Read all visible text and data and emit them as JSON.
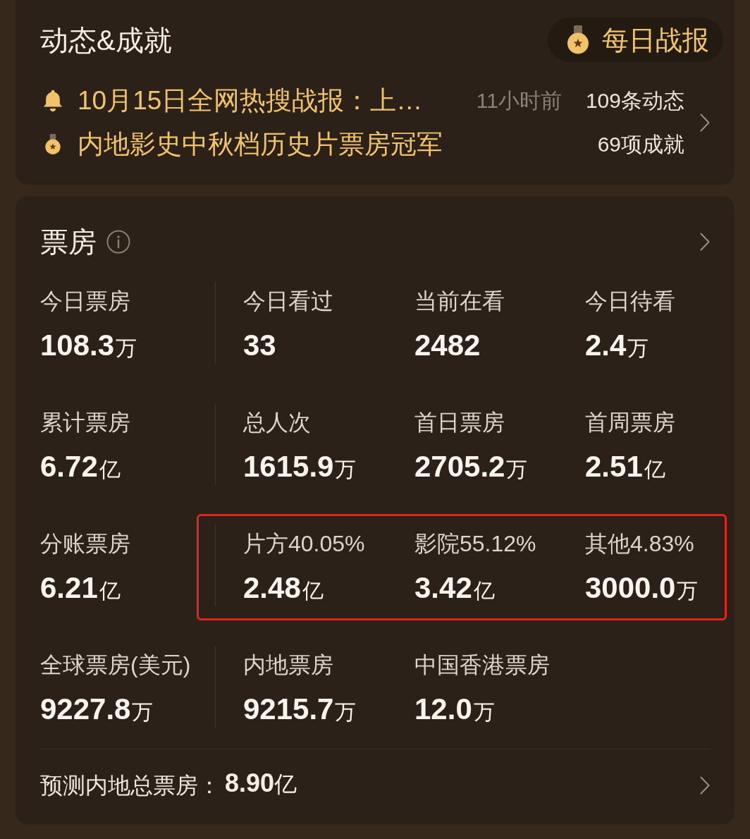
{
  "achievements": {
    "title": "动态&成就",
    "daily_report_button": "每日战报",
    "items": [
      {
        "kind": "news",
        "text": "10月15日全网热搜战报：上…",
        "time": "11小时前",
        "count": "109条动态"
      },
      {
        "kind": "achievement",
        "text": "内地影史中秋档历史片票房冠军",
        "count": "69项成就"
      }
    ]
  },
  "box_office": {
    "title": "票房",
    "rows": [
      {
        "highlighted": false,
        "cells": [
          {
            "label": "今日票房",
            "number": "108.3",
            "unit": "万"
          },
          {
            "label": "今日看过",
            "number": "33"
          },
          {
            "label": "当前在看",
            "number": "2482"
          },
          {
            "label": "今日待看",
            "number": "2.4",
            "unit": "万"
          }
        ]
      },
      {
        "highlighted": false,
        "cells": [
          {
            "label": "累计票房",
            "number": "6.72",
            "unit": "亿"
          },
          {
            "label": "总人次",
            "number": "1615.9",
            "unit": "万"
          },
          {
            "label": "首日票房",
            "number": "2705.2",
            "unit": "万"
          },
          {
            "label": "首周票房",
            "number": "2.51",
            "unit": "亿"
          }
        ]
      },
      {
        "highlighted": true,
        "cells": [
          {
            "label": "分账票房",
            "number": "6.21",
            "unit": "亿"
          },
          {
            "label": "片方40.05%",
            "number": "2.48",
            "unit": "亿"
          },
          {
            "label": "影院55.12%",
            "number": "3.42",
            "unit": "亿"
          },
          {
            "label": "其他4.83%",
            "number": "3000.0",
            "unit": "万"
          }
        ]
      },
      {
        "highlighted": false,
        "cells": [
          {
            "label": "全球票房(美元)",
            "number": "9227.8",
            "unit": "万"
          },
          {
            "label": "内地票房",
            "number": "9215.7",
            "unit": "万"
          },
          {
            "label": "中国香港票房",
            "number": "12.0",
            "unit": "万"
          }
        ]
      }
    ],
    "forecast": {
      "label": "预测内地总票房：",
      "number": "8.90",
      "unit": "亿"
    }
  }
}
